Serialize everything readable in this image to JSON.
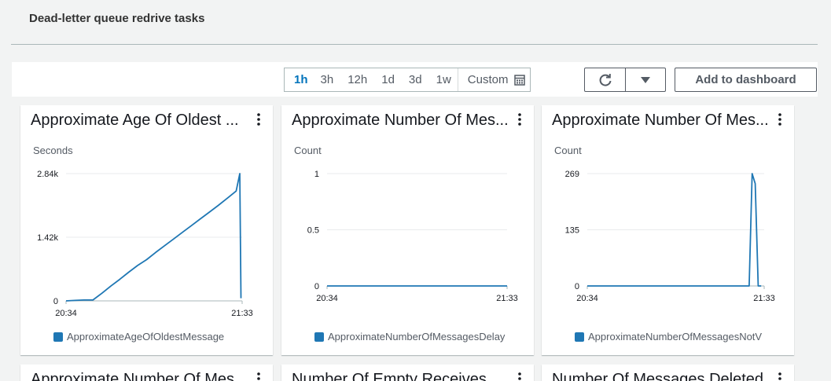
{
  "section": {
    "title": "Dead-letter queue redrive tasks"
  },
  "toolbar": {
    "ranges": [
      "1h",
      "3h",
      "12h",
      "1d",
      "3d",
      "1w"
    ],
    "active_range": "1h",
    "custom_label": "Custom",
    "refresh_icon": "refresh-icon",
    "dropdown_icon": "caret-down-icon",
    "add_label": "Add to dashboard"
  },
  "colors": {
    "series": "#1f77b4",
    "accent": "#0073bb",
    "grid": "#e9ebed"
  },
  "widgets": [
    {
      "title": "Approximate Age Of Oldest ...",
      "unit": "Seconds",
      "legend": "ApproximateAgeOfOldestMessage"
    },
    {
      "title": "Approximate Number Of Mes...",
      "unit": "Count",
      "legend": "ApproximateNumberOfMessagesDelay"
    },
    {
      "title": "Approximate Number Of Mes...",
      "unit": "Count",
      "legend": "ApproximateNumberOfMessagesNotV"
    },
    {
      "title": "Approximate Number Of Mes..."
    },
    {
      "title": "Number Of Empty Receives"
    },
    {
      "title": "Number Of Messages Deleted"
    }
  ],
  "chart_data": [
    {
      "type": "line",
      "ylabel": "Seconds",
      "yticks": [
        "0",
        "1.42k",
        "2.84k"
      ],
      "xticks": [
        "20:34",
        "21:33"
      ],
      "ylim": [
        0,
        2840
      ],
      "xlim": [
        0,
        59
      ],
      "series": [
        {
          "name": "ApproximateAgeOfOldestMessage",
          "x": [
            0,
            3,
            6,
            9,
            12,
            15,
            18,
            21,
            24,
            27,
            30,
            33,
            36,
            39,
            42,
            45,
            48,
            51,
            54,
            57,
            58.2,
            58.6
          ],
          "values": [
            0,
            10,
            20,
            20,
            170,
            330,
            480,
            640,
            790,
            920,
            1080,
            1230,
            1380,
            1530,
            1680,
            1830,
            1980,
            2130,
            2290,
            2450,
            2840,
            60
          ]
        }
      ]
    },
    {
      "type": "line",
      "ylabel": "Count",
      "yticks": [
        "0",
        "0.5",
        "1"
      ],
      "xticks": [
        "20:34",
        "21:33"
      ],
      "ylim": [
        0,
        1
      ],
      "xlim": [
        0,
        59
      ],
      "series": [
        {
          "name": "ApproximateNumberOfMessagesDelay",
          "x": [
            0,
            59
          ],
          "values": [
            0,
            0
          ]
        }
      ]
    },
    {
      "type": "line",
      "ylabel": "Count",
      "yticks": [
        "0",
        "135",
        "269"
      ],
      "xticks": [
        "20:34",
        "21:33"
      ],
      "ylim": [
        0,
        269
      ],
      "xlim": [
        0,
        59
      ],
      "series": [
        {
          "name": "ApproximateNumberOfMessagesNotV",
          "x": [
            0,
            54,
            55,
            56,
            57,
            58
          ],
          "values": [
            0,
            0,
            269,
            245,
            0,
            0
          ]
        }
      ]
    }
  ]
}
